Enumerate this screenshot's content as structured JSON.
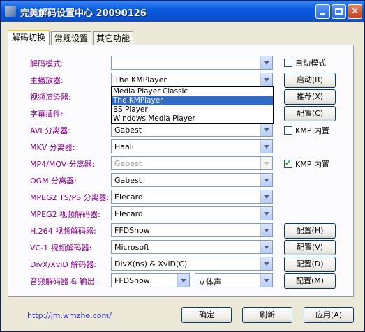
{
  "window": {
    "title": "完美解码设置中心 20090126"
  },
  "tabs": [
    {
      "label": "解码切换"
    },
    {
      "label": "常规设置"
    },
    {
      "label": "其它功能"
    }
  ],
  "rows": [
    {
      "label": "解码模式:",
      "value": ""
    },
    {
      "label": "主播放器:",
      "value": "The KMPlayer"
    },
    {
      "label": "视频渲染器:",
      "value": ""
    },
    {
      "label": "字幕插件:",
      "value": ""
    },
    {
      "label": "AVI 分离器:",
      "value": "Gabest"
    },
    {
      "label": "MKV 分离器:",
      "value": "Haali"
    },
    {
      "label": "MP4/MOV 分离器:",
      "value": "Gabest"
    },
    {
      "label": "OGM 分离器:",
      "value": "Gabest"
    },
    {
      "label": "MPEG2 TS/PS 分离器:",
      "value": "Elecard"
    },
    {
      "label": "MPEG2 视频解码器:",
      "value": "Elecard"
    },
    {
      "label": "H.264 视频解码器:",
      "value": "FFDShow"
    },
    {
      "label": "VC-1 视频解码器:",
      "value": "Microsoft"
    },
    {
      "label": "DivX/XviD 解码器:",
      "value": "DivX(ns) & XviD(C)"
    },
    {
      "label": "音频解码器 & 输出:",
      "value": "FFDShow",
      "value2": "立体声"
    }
  ],
  "dropdown": {
    "options": [
      "Media Player Classic",
      "The KMPlayer",
      "BS Player",
      "Windows Media Player"
    ],
    "selected": "The KMPlayer"
  },
  "side": {
    "auto_mode": "自动模式",
    "launch": "启动(R)",
    "recommend": "推荐(X)",
    "config_c": "配置(C)",
    "kmp_builtin_avi": "KMP 内置",
    "kmp_builtin_mp4": "KMP 内置",
    "config_h": "配置(H)",
    "config_v": "配置(V)",
    "config_d": "配置(D)",
    "config_m": "配置(M)"
  },
  "footer": {
    "link": "http://jm.wmzhe.com/",
    "ok": "确定",
    "refresh": "刷新",
    "apply": "应用(A)"
  }
}
